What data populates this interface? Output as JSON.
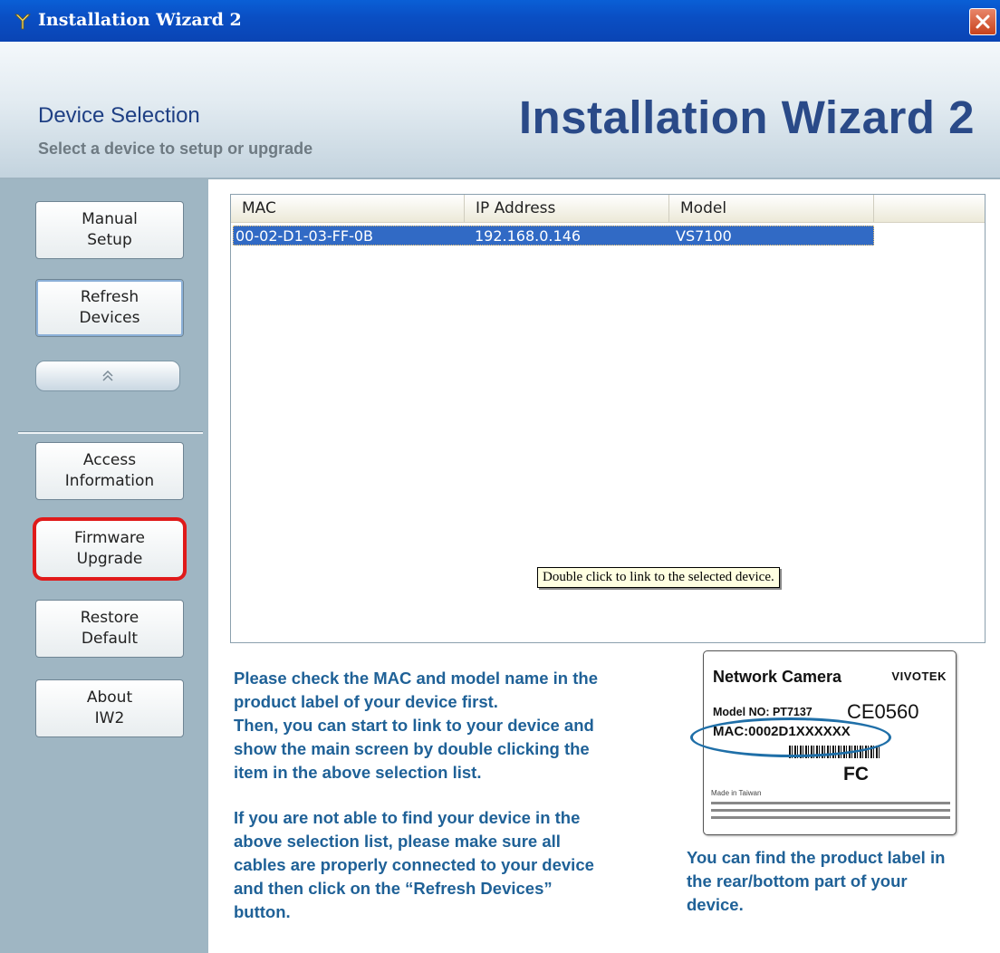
{
  "window": {
    "title": "Installation Wizard 2"
  },
  "header": {
    "heading": "Device Selection",
    "subheading": "Select a device to setup or upgrade",
    "brand": "Installation Wizard 2"
  },
  "sidebar": {
    "buttons": [
      {
        "label": "Manual\nSetup"
      },
      {
        "label": "Refresh\nDevices"
      },
      {
        "label": "Access\nInformation"
      },
      {
        "label": "Firmware\nUpgrade"
      },
      {
        "label": "Restore\nDefault"
      },
      {
        "label": "About\nIW2"
      }
    ]
  },
  "device_list": {
    "columns": [
      "MAC",
      "IP Address",
      "Model"
    ],
    "rows": [
      {
        "mac": "00-02-D1-03-FF-0B",
        "ip": "192.168.0.146",
        "model": "VS7100",
        "selected": true
      }
    ],
    "tooltip": "Double click to link to the selected device."
  },
  "help": {
    "paragraph1": "Please check the MAC and model name in the\nproduct label of your device first.\nThen, you can start to link to your device and\nshow the main screen by double clicking the\nitem in the above selection list.",
    "paragraph2": "If you are not able to find your device in the\nabove selection list, please make sure all\ncables are properly connected to your device\nand then click on the “Refresh Devices”\nbutton."
  },
  "product_label": {
    "title": "Network Camera",
    "brand": "VIVOTEK",
    "model": "Model NO: PT7137",
    "cert": "CE0560",
    "mac": "MAC:0002D1XXXXXX",
    "fcc": "FC",
    "made_in": "Made in Taiwan"
  },
  "find_label_text": "You can find the product label in\nthe rear/bottom part of your\ndevice.",
  "colors": {
    "titlebar": "#0a4fc4",
    "sidebar": "#9fb6c3",
    "selection": "#316ac5",
    "help_text": "#1f6197",
    "highlight": "#e01a1a"
  }
}
